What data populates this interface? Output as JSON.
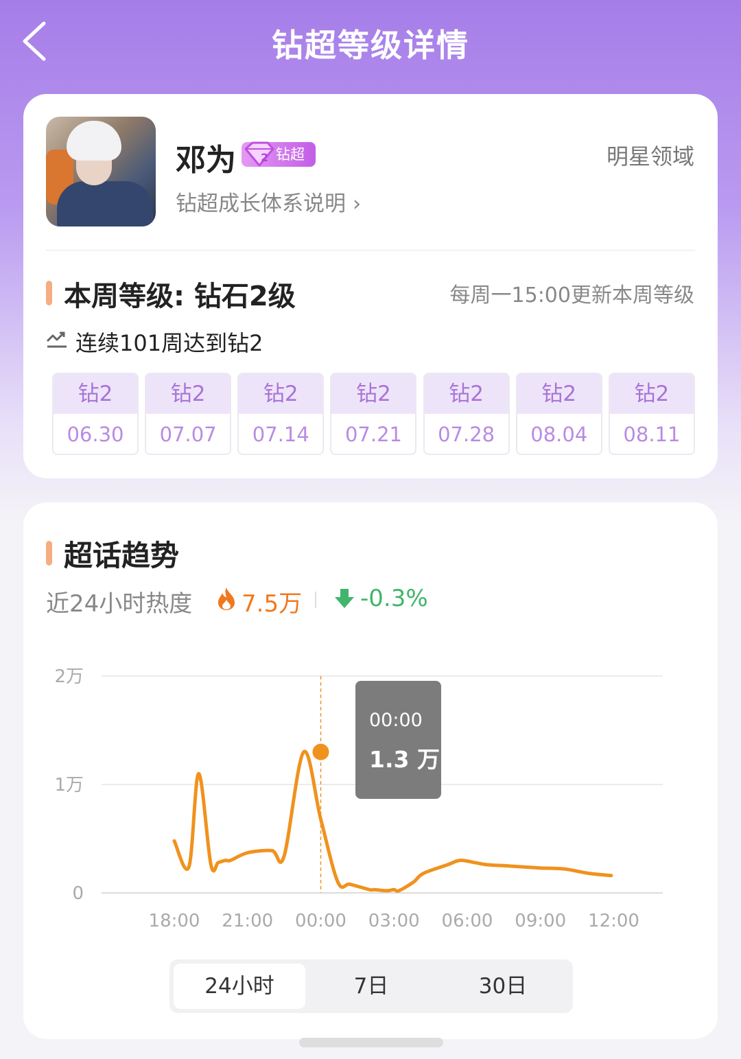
{
  "header": {
    "title": "钻超等级详情"
  },
  "profile": {
    "name": "邓为",
    "badge_label": "钻超",
    "badge_level": "2",
    "growth_link": "钻超成长体系说明",
    "domain_label": "明星领域"
  },
  "week_level": {
    "title": "本周等级: 钻石2级",
    "update_note": "每周一15:00更新本周等级",
    "streak": "连续101周达到钻2",
    "history": [
      {
        "level": "钻2",
        "date": "06.30"
      },
      {
        "level": "钻2",
        "date": "07.07"
      },
      {
        "level": "钻2",
        "date": "07.14"
      },
      {
        "level": "钻2",
        "date": "07.21"
      },
      {
        "level": "钻2",
        "date": "07.28"
      },
      {
        "level": "钻2",
        "date": "08.04"
      },
      {
        "level": "钻2",
        "date": "08.11"
      }
    ]
  },
  "trend": {
    "title": "超话趋势",
    "heat_label": "近24小时热度",
    "heat_value": "7.5万",
    "change": "-0.3%",
    "tooltip": {
      "time": "00:00",
      "value": "1.3 万"
    },
    "ranges": [
      "24小时",
      "7日",
      "30日"
    ],
    "active_range": "24小时"
  },
  "colors": {
    "accent_line": "#f0921e",
    "up_fire": "#f0781e",
    "down_green": "#41b56b",
    "level_purple": "#a874d8"
  },
  "chart_data": {
    "type": "line",
    "y_ticks": [
      "0",
      "1万",
      "2万"
    ],
    "x_ticks": [
      "18:00",
      "21:00",
      "00:00",
      "03:00",
      "06:00",
      "09:00",
      "12:00"
    ],
    "ylim": [
      0,
      20000
    ],
    "grid": true,
    "highlight": {
      "x": "00:00",
      "value": 13000
    },
    "x_hours": [
      -3.0,
      -2.4,
      -2.0,
      -1.5,
      -1.2,
      -0.9,
      -0.7,
      0.0,
      1.0,
      1.5,
      2.3,
      3.0,
      3.7,
      4.2,
      5.0,
      5.2,
      5.7,
      6.0,
      6.2,
      6.8,
      7.2,
      8.2,
      8.7,
      9.3,
      9.8,
      10.6,
      11.3,
      12.0,
      13.0,
      14.0,
      14.9
    ],
    "values": [
      4800,
      2400,
      11000,
      2600,
      2800,
      3000,
      3000,
      3700,
      3900,
      3400,
      13000,
      6800,
      1000,
      800,
      300,
      300,
      200,
      300,
      200,
      1000,
      1800,
      2600,
      3000,
      2800,
      2600,
      2500,
      2400,
      2300,
      2200,
      1800,
      1600
    ]
  }
}
